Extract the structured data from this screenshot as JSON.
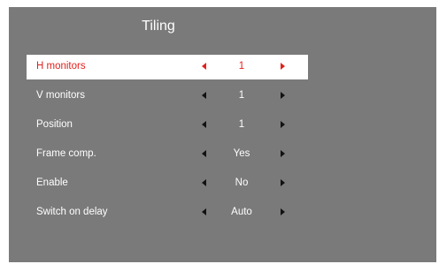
{
  "title": "Tiling",
  "colors": {
    "panel_background": "#7a7a7a",
    "selected_row_background": "#ffffff",
    "selected_text": "#e2211c",
    "text": "#ffffff",
    "arrow": "#111111"
  },
  "menu": {
    "selected_index": 0,
    "items": [
      {
        "label": "H monitors",
        "value": "1"
      },
      {
        "label": "V monitors",
        "value": "1"
      },
      {
        "label": "Position",
        "value": "1"
      },
      {
        "label": "Frame comp.",
        "value": "Yes"
      },
      {
        "label": "Enable",
        "value": "No"
      },
      {
        "label": "Switch on delay",
        "value": "Auto"
      }
    ]
  }
}
